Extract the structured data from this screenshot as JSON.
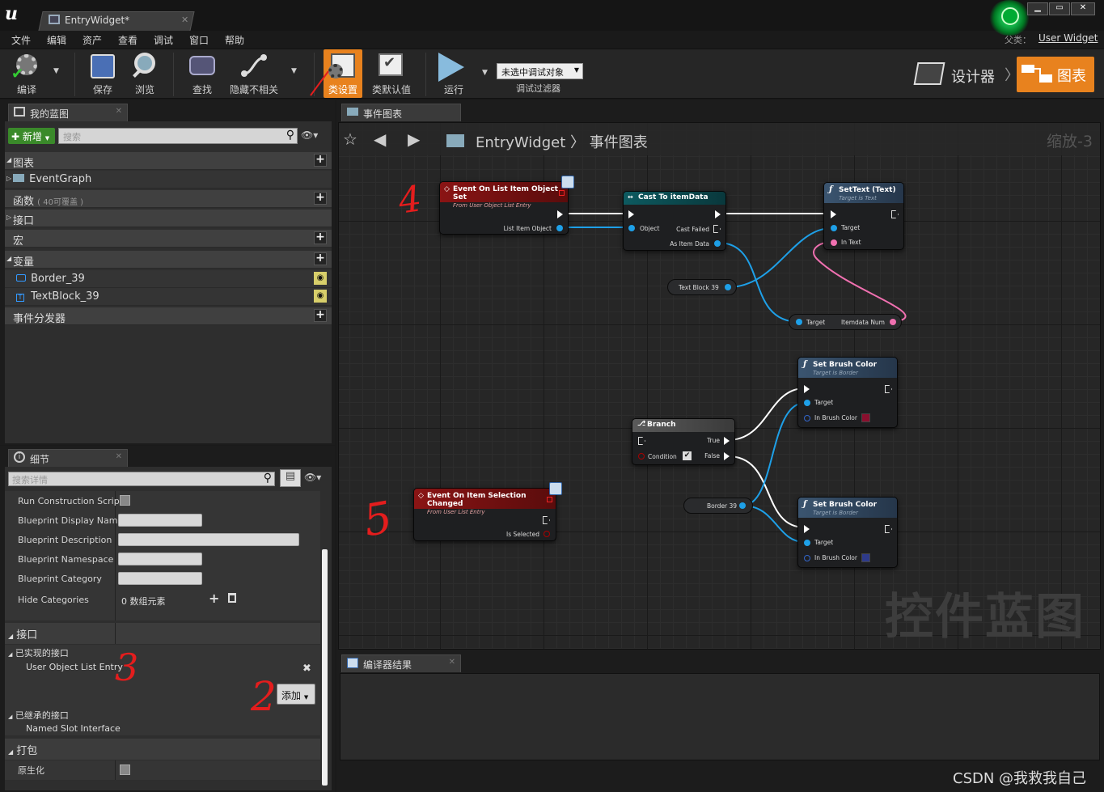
{
  "window": {
    "tab_title": "EntryWidget*",
    "parent_label": "父类：",
    "parent_value": "User Widget"
  },
  "menu": [
    "文件",
    "编辑",
    "资产",
    "查看",
    "调试",
    "窗口",
    "帮助"
  ],
  "toolbar": {
    "compile": "编译",
    "save": "保存",
    "browse": "浏览",
    "find": "查找",
    "hide_unrelated": "隐藏不相关",
    "class_settings": "类设置",
    "class_defaults": "类默认值",
    "run": "运行",
    "debug_select": "未选中调试对象",
    "debug_filter": "调试过滤器",
    "designer": "设计器",
    "graph": "图表"
  },
  "my_blueprint": {
    "tab": "我的蓝图",
    "add_new": "新增",
    "search_placeholder": "搜索",
    "sections": {
      "graphs": "图表",
      "event_graph": "EventGraph",
      "functions": "函数",
      "functions_note": "( 40可覆盖 )",
      "interfaces": "接口",
      "macros": "宏",
      "variables": "变量",
      "var1": "Border_39",
      "var2": "TextBlock_39",
      "dispatchers": "事件分发器"
    }
  },
  "details": {
    "tab": "细节",
    "search_placeholder": "搜索详情",
    "rows": {
      "run_construction": "Run Construction Script",
      "display_name": "Blueprint Display Name",
      "description": "Blueprint Description",
      "namespace": "Blueprint Namespace",
      "category": "Blueprint Category",
      "hide_categories": "Hide Categories",
      "hide_categories_value": "0 数组元素"
    },
    "interfaces_header": "接口",
    "implemented": "已实现的接口",
    "implemented_item": "User Object List Entry",
    "add_button": "添加",
    "inherited": "已继承的接口",
    "inherited_item": "Named Slot Interface",
    "packaging": "打包",
    "nativize": "原生化"
  },
  "graph": {
    "tab": "事件图表",
    "breadcrumb_root": "EntryWidget",
    "breadcrumb_sep": "〉",
    "breadcrumb_leaf": "事件图表",
    "zoom": "缩放-3",
    "watermark": "控件蓝图",
    "nodes": {
      "event_set": {
        "title": "Event On List Item Object Set",
        "subtitle": "From User Object List Entry",
        "pin": "List Item Object"
      },
      "cast": {
        "title": "Cast To itemData",
        "pin_object": "Object",
        "pin_failed": "Cast Failed",
        "pin_as": "As Item Data"
      },
      "settext": {
        "title": "SetText (Text)",
        "subtitle": "Target is Text",
        "pin_target": "Target",
        "pin_text": "In Text"
      },
      "textblock_var": "Text Block 39",
      "itemdata": {
        "pin_target": "Target",
        "pin_num": "Itemdata Num"
      },
      "setbrush1": {
        "title": "Set Brush Color",
        "subtitle": "Target is Border",
        "pin_target": "Target",
        "pin_color": "In Brush Color"
      },
      "branch": {
        "title": "Branch",
        "pin_true": "True",
        "pin_false": "False",
        "pin_condition": "Condition"
      },
      "border_var": "Border 39",
      "setbrush2": {
        "title": "Set Brush Color",
        "subtitle": "Target is Border",
        "pin_target": "Target",
        "pin_color": "In Brush Color"
      },
      "event_changed": {
        "title": "Event On Item Selection Changed",
        "subtitle": "From User List Entry",
        "pin": "Is Selected"
      }
    }
  },
  "compiler": {
    "tab": "编译器结果"
  },
  "annotations": [
    "4",
    "5",
    "3",
    "2"
  ],
  "footer_watermark": "CSDN @我救我自己",
  "colors": {
    "event_header": "#8a1414",
    "cast_header": "#0d5a60",
    "func_header": "#3b5570",
    "accent_orange": "#e8821e",
    "pin_blue": "#1ea0e8",
    "pin_pink": "#f070b0",
    "brush_color_1": "#8a0f2e",
    "brush_color_2": "#2e3a8a"
  }
}
